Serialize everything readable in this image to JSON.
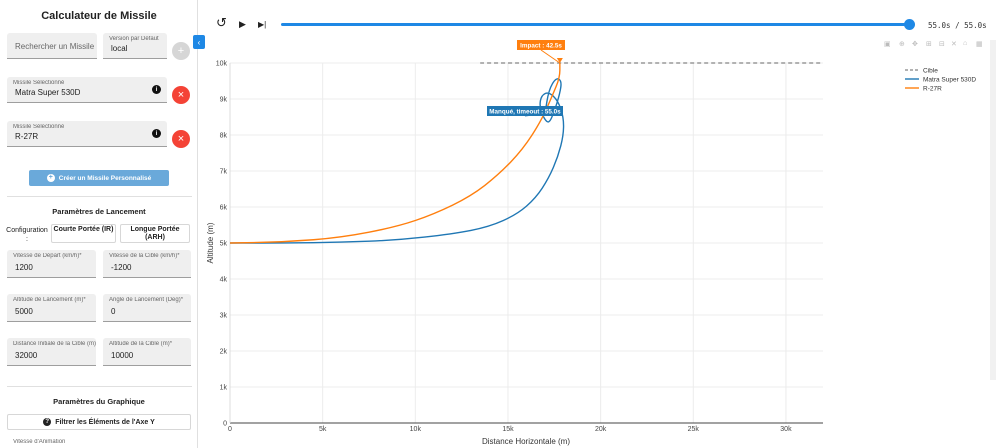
{
  "sidebar": {
    "title": "Calculateur de Missile",
    "search_placeholder": "Rechercher un Missile",
    "version": {
      "label": "Version par Défaut",
      "value": "local"
    },
    "missiles": [
      {
        "label": "Missile Sélectionné",
        "value": "Matra Super 530D"
      },
      {
        "label": "Missile Sélectionné",
        "value": "R-27R"
      }
    ],
    "create_button": "Créer un Missile Personnalisé",
    "launch_section_title": "Paramètres de Lancement",
    "configuration_label": "Configuration :",
    "config_options": [
      "Courte Portée (IR)",
      "Longue Portée (ARH)"
    ],
    "fields": [
      {
        "label": "Vitesse de Départ (km/h)*",
        "value": "1200"
      },
      {
        "label": "Vitesse de la Cible (km/h)*",
        "value": "-1200"
      },
      {
        "label": "Altitude de Lancement (m)*",
        "value": "5000"
      },
      {
        "label": "Angle de Lancement (Deg)*",
        "value": "0"
      },
      {
        "label": "Distance Initiale de la Cible (m)",
        "value": "32000"
      },
      {
        "label": "Altitude de la Cible (m)*",
        "value": "10000"
      }
    ],
    "graph_section_title": "Paramètres du Graphique",
    "filter_button": "Filtrer les Éléments de l'Axe Y",
    "animation_speed_label": "Vitesse d'Animation"
  },
  "player": {
    "time_display": "55.0s / 55.0s",
    "progress": 1.0
  },
  "chart_data": {
    "type": "line",
    "xlabel": "Distance Horizontale (m)",
    "ylabel": "Altitude (m)",
    "xlim": [
      0,
      32000
    ],
    "ylim": [
      0,
      10000
    ],
    "x_ticks": [
      "0",
      "5k",
      "10k",
      "15k",
      "20k",
      "25k",
      "30k"
    ],
    "y_ticks": [
      "0",
      "1k",
      "2k",
      "3k",
      "4k",
      "5k",
      "6k",
      "7k",
      "8k",
      "9k",
      "10k"
    ],
    "legend": {
      "position": "top-right"
    },
    "series": [
      {
        "name": "Cible",
        "color": "#999999",
        "dash": true,
        "x": [
          13500,
          32000
        ],
        "y": [
          10000,
          10000
        ]
      },
      {
        "name": "Matra Super 530D",
        "color": "#1f77b4",
        "x": [
          0,
          3000,
          6000,
          9000,
          12000,
          14000,
          15500,
          16500,
          17200,
          17700,
          18000,
          18000,
          17700,
          17200,
          16800,
          16700,
          16900,
          17200,
          17500,
          17800,
          17900,
          17600,
          17200,
          17000
        ],
        "y": [
          5000,
          5000,
          5020,
          5080,
          5250,
          5450,
          5800,
          6250,
          6800,
          7400,
          8000,
          8500,
          8950,
          9200,
          9100,
          8800,
          8500,
          8300,
          8650,
          9150,
          9500,
          9600,
          9250,
          8600
        ]
      },
      {
        "name": "R-27R",
        "color": "#ff7f0e",
        "x": [
          0,
          3000,
          6000,
          9000,
          11000,
          13000,
          14500,
          15800,
          16800,
          17400,
          17800,
          17800
        ],
        "y": [
          5000,
          5030,
          5150,
          5450,
          5800,
          6300,
          6900,
          7600,
          8400,
          9100,
          9600,
          10000
        ]
      }
    ],
    "annotations": [
      {
        "text": "Impact : 42.5s",
        "color": "#ff7f0e",
        "x": 17800,
        "y": 10000
      },
      {
        "text": "Manqué, timeout : 55.0s",
        "color": "#1f77b4",
        "x": 17000,
        "y": 8600
      }
    ]
  }
}
